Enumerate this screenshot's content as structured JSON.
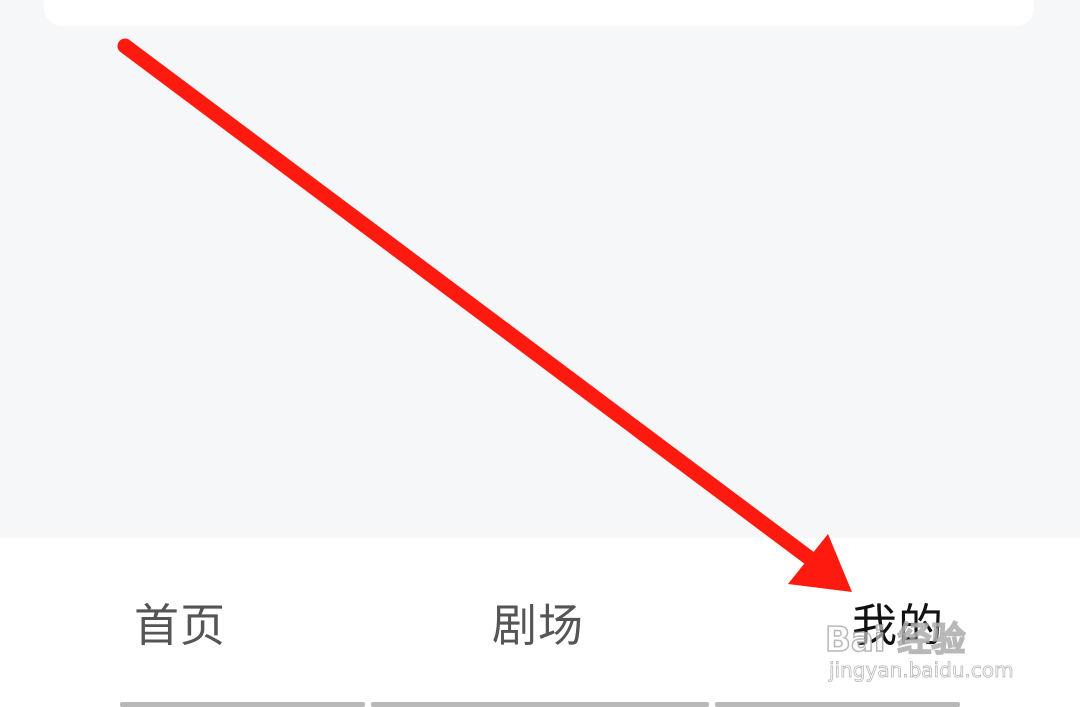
{
  "tab_bar": {
    "tabs": [
      {
        "label": "首页",
        "active": false
      },
      {
        "label": "剧场",
        "active": false
      },
      {
        "label": "我的",
        "active": true
      }
    ]
  },
  "watermark": {
    "brand": "Bai 经验",
    "url": "jingyan.baidu.com"
  },
  "colors": {
    "background": "#f6f7f9",
    "tab_bar": "#ffffff",
    "arrow": "#ff1a10",
    "tab_text": "#555555",
    "tab_text_active": "#111111"
  },
  "annotation": {
    "type": "arrow",
    "points_to": "我的"
  }
}
